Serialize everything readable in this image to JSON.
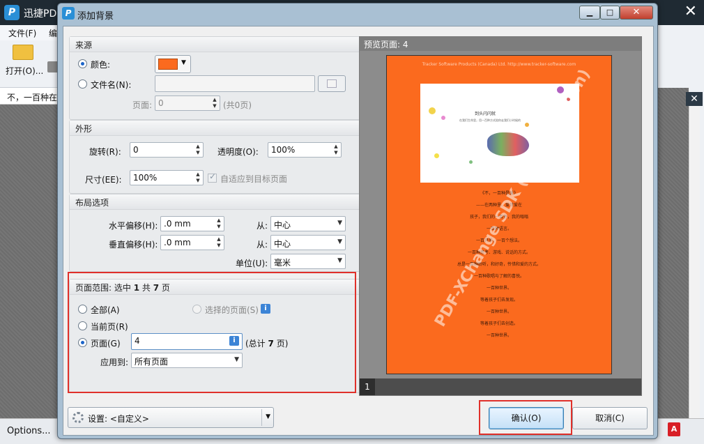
{
  "app": {
    "title": "迅捷PD",
    "logo_letter": "P",
    "close_glyph": "✕",
    "menu": {
      "file": "文件(F)",
      "edit": "编"
    },
    "toolbar": {
      "open_label": "打开(O)..."
    },
    "doc_tab": "不，一百种在",
    "status": {
      "options_label": "Options..."
    },
    "right_close": "✕"
  },
  "dialog": {
    "title": "添加背景",
    "buttons": {
      "minimize": "▁",
      "maximize": "□",
      "close": "✕"
    },
    "source": {
      "header": "来源",
      "color_label": "颜色:",
      "color_value": "#fb6a1e",
      "filename_label": "文件名(N):",
      "filename_value": "",
      "pages_label": "页面:",
      "pages_value": "0",
      "pages_total": "(共0页)"
    },
    "appearance": {
      "header": "外形",
      "rotation_label": "旋转(R):",
      "rotation_value": "0",
      "opacity_label": "透明度(O):",
      "opacity_value": "100%",
      "size_label": "尺寸(EE):",
      "size_value": "100%",
      "fit_label": "自适应到目标页面",
      "fit_checked": true
    },
    "layout": {
      "header": "布局选项",
      "h_offset_label": "水平偏移(H):",
      "h_offset_value": ".0 mm",
      "v_offset_label": "垂直偏移(H):",
      "v_offset_value": ".0 mm",
      "from_label": "从:",
      "h_from_value": "中心",
      "v_from_value": "中心",
      "unit_label": "单位(U):",
      "unit_value": "毫米"
    },
    "page_range": {
      "header_prefix": "页面范围: 选中",
      "selected": "1",
      "header_mid": "共",
      "total": "7",
      "header_suffix": "页",
      "all_label": "全部(A)",
      "selected_pages_label": "选择的页面(S)",
      "current_label": "当前页(R)",
      "pages_label": "页面(G)",
      "pages_value": "4",
      "pages_total_prefix": "(总计",
      "pages_total_num": "7",
      "pages_total_suffix": "页)",
      "apply_label": "应用到:",
      "apply_value": "所有页面",
      "info_glyph": "i"
    },
    "preview": {
      "header": "预览页面: 4",
      "page_number": "1",
      "page_header_text": "Tracker Software Products (Canada) Ltd. http://www.tracker-software.com",
      "image_title": "到头闪闪就",
      "image_subtitle": "在我们生命里，用一百种方式陪你走我们小时候的",
      "text_lines": [
        "《不，一百种是爱》",
        "——在两种里、爱世爱在",
        "孩子，我们的一百件，我的嗡嗡",
        "一百种语言。",
        "一百只手，一百个想法。",
        "一百种思考、游戏、说话的方式。",
        "总是一百种聆听，和好奇，怜惜和爱的方式。",
        "一百种歌唱与了解的喜悦。",
        "一百种世界。",
        "等着孩子们去发现。",
        "一百种世界。",
        "等着孩子们去创造。",
        "一百种世界。"
      ],
      "watermark": "PDF-XChange SDK (Demo version)"
    },
    "settings_label": "设置:",
    "settings_value": "<自定义>",
    "ok_label": "确认(O)",
    "cancel_label": "取消(C)"
  }
}
